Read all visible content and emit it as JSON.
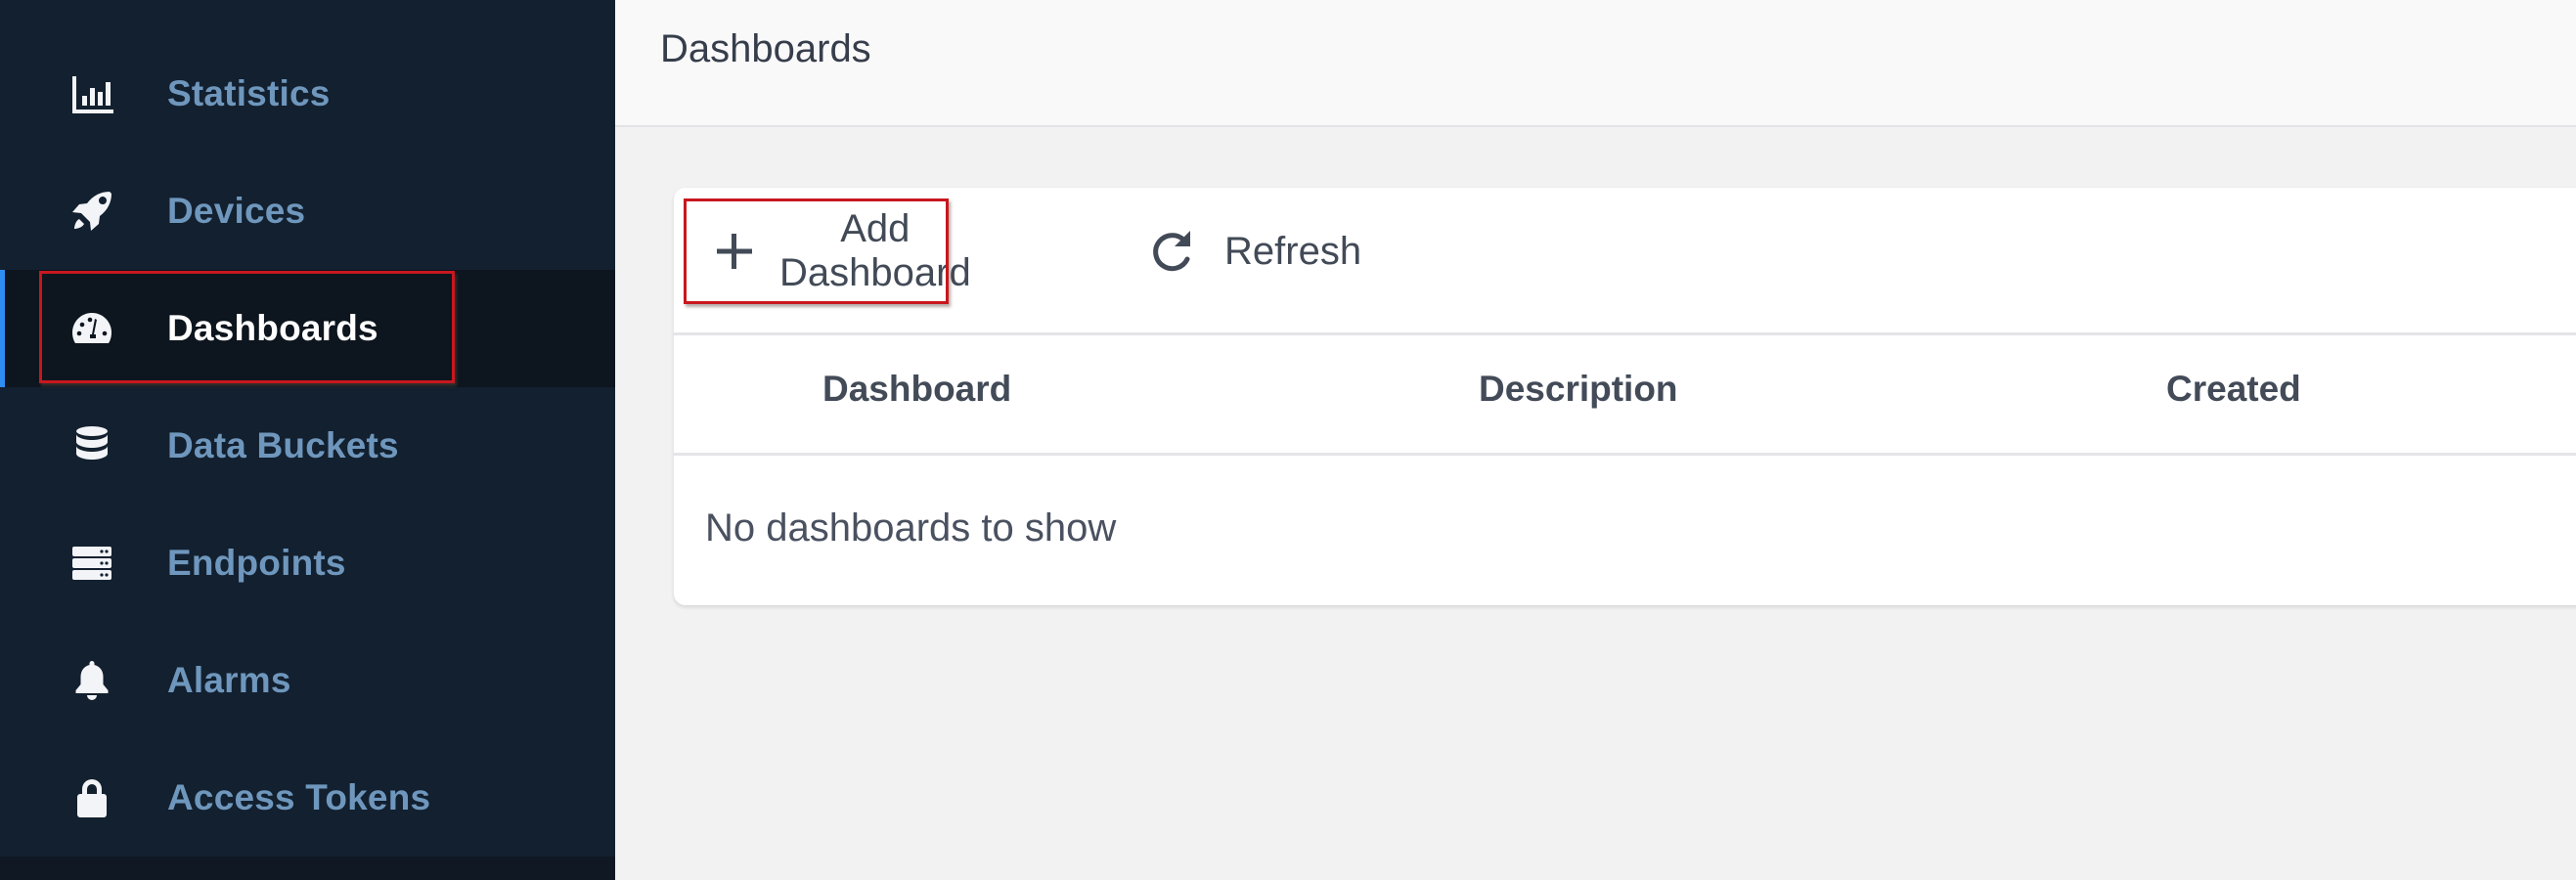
{
  "sidebar": {
    "items": [
      {
        "label": "Statistics",
        "icon": "bar-chart-icon",
        "active": false
      },
      {
        "label": "Devices",
        "icon": "rocket-icon",
        "active": false
      },
      {
        "label": "Dashboards",
        "icon": "tachometer-icon",
        "active": true
      },
      {
        "label": "Data Buckets",
        "icon": "database-icon",
        "active": false
      },
      {
        "label": "Endpoints",
        "icon": "server-icon",
        "active": false
      },
      {
        "label": "Alarms",
        "icon": "bell-icon",
        "active": false
      },
      {
        "label": "Access Tokens",
        "icon": "lock-icon",
        "active": false
      }
    ],
    "accent_color": "#2f8cf0"
  },
  "header": {
    "title": "Dashboards"
  },
  "toolbar": {
    "add_label": "Add Dashboard",
    "add_icon": "plus-icon",
    "refresh_label": "Refresh",
    "refresh_icon": "refresh-icon"
  },
  "table": {
    "columns": [
      "Dashboard",
      "Description",
      "Created"
    ],
    "rows": [],
    "empty_message": "No dashboards to show"
  },
  "highlight_color": "#c8171e"
}
